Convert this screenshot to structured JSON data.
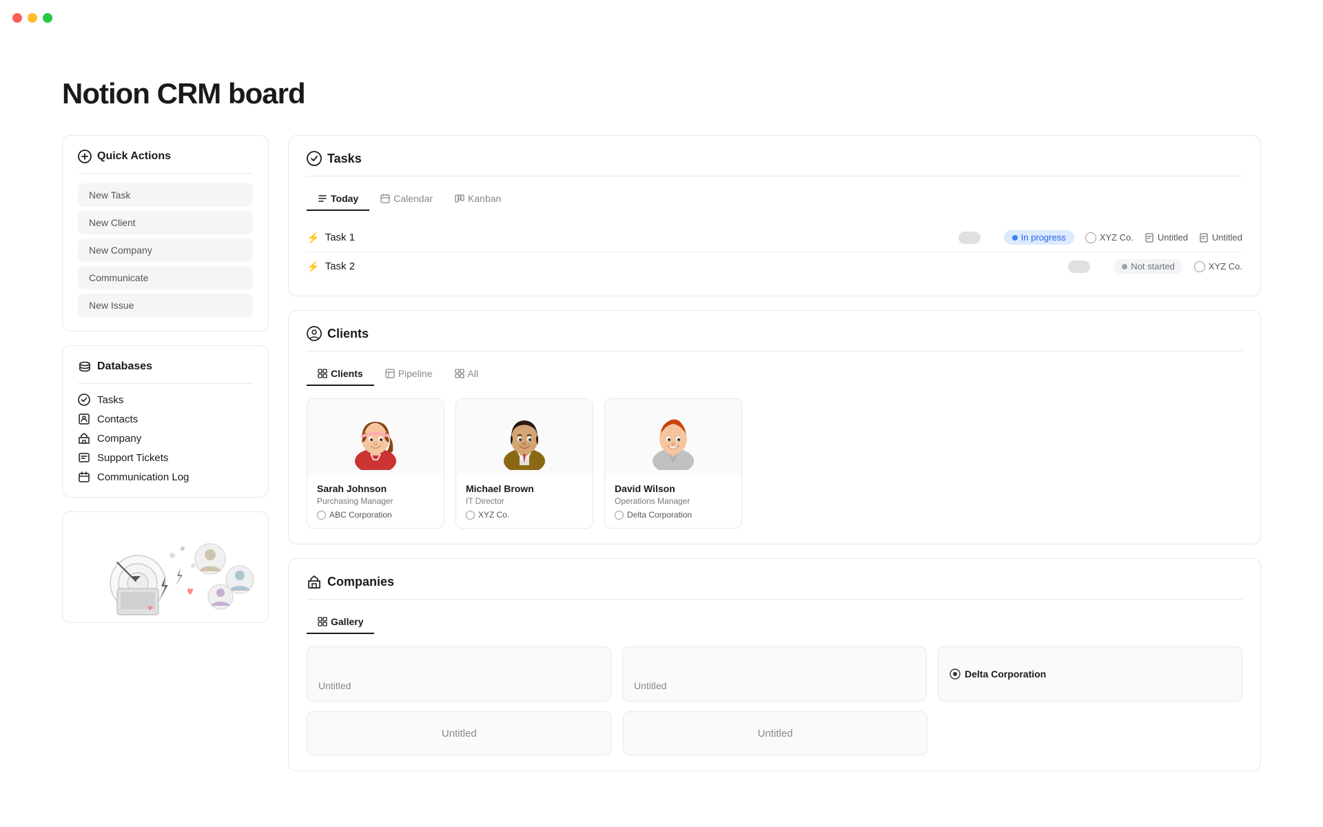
{
  "app": {
    "title": "Notion CRM board"
  },
  "titlebar": {
    "dots": [
      "red",
      "yellow",
      "green"
    ]
  },
  "quickActions": {
    "header": "Quick Actions",
    "items": [
      {
        "label": "New Task",
        "id": "new-task"
      },
      {
        "label": "New Client",
        "id": "new-client"
      },
      {
        "label": "New Company",
        "id": "new-company"
      },
      {
        "label": "Communicate",
        "id": "communicate"
      },
      {
        "label": "New Issue",
        "id": "new-issue"
      }
    ]
  },
  "databases": {
    "header": "Databases",
    "items": [
      {
        "label": "Tasks",
        "icon": "check-circle",
        "id": "db-tasks"
      },
      {
        "label": "Contacts",
        "icon": "contacts",
        "id": "db-contacts"
      },
      {
        "label": "Company",
        "icon": "company",
        "id": "db-company"
      },
      {
        "label": "Support Tickets",
        "icon": "support",
        "id": "db-support"
      },
      {
        "label": "Communication Log",
        "icon": "calendar",
        "id": "db-communication"
      }
    ]
  },
  "tasks": {
    "header": "Tasks",
    "tabs": [
      {
        "label": "Today",
        "icon": "list",
        "active": true
      },
      {
        "label": "Calendar",
        "icon": "calendar"
      },
      {
        "label": "Kanban",
        "icon": "kanban"
      }
    ],
    "rows": [
      {
        "name": "Task 1",
        "status": "In progress",
        "statusType": "in-progress",
        "company": "XYZ Co.",
        "doc1": "Untitled",
        "doc2": "Untitled"
      },
      {
        "name": "Task 2",
        "status": "Not started",
        "statusType": "not-started",
        "company": "XYZ Co."
      }
    ]
  },
  "clients": {
    "header": "Clients",
    "tabs": [
      {
        "label": "Clients",
        "icon": "grid",
        "active": true
      },
      {
        "label": "Pipeline",
        "icon": "table"
      },
      {
        "label": "All",
        "icon": "grid2"
      }
    ],
    "cards": [
      {
        "name": "Sarah Johnson",
        "role": "Purchasing Manager",
        "company": "ABC Corporation",
        "avatarId": "sarah"
      },
      {
        "name": "Michael Brown",
        "role": "IT Director",
        "company": "XYZ Co.",
        "avatarId": "michael"
      },
      {
        "name": "David Wilson",
        "role": "Operations Manager",
        "company": "Delta Corporation",
        "avatarId": "david"
      }
    ]
  },
  "companies": {
    "header": "Companies",
    "tabs": [
      {
        "label": "Gallery",
        "icon": "grid",
        "active": true
      }
    ],
    "gallery": [
      {
        "label": "Untitled",
        "named": false
      },
      {
        "label": "Untitled",
        "named": false
      },
      {
        "label": "Delta Corporation",
        "named": true
      }
    ],
    "bottomCards": [
      {
        "label": "Untitled",
        "named": false
      },
      {
        "label": "Untitled",
        "named": false
      }
    ]
  }
}
